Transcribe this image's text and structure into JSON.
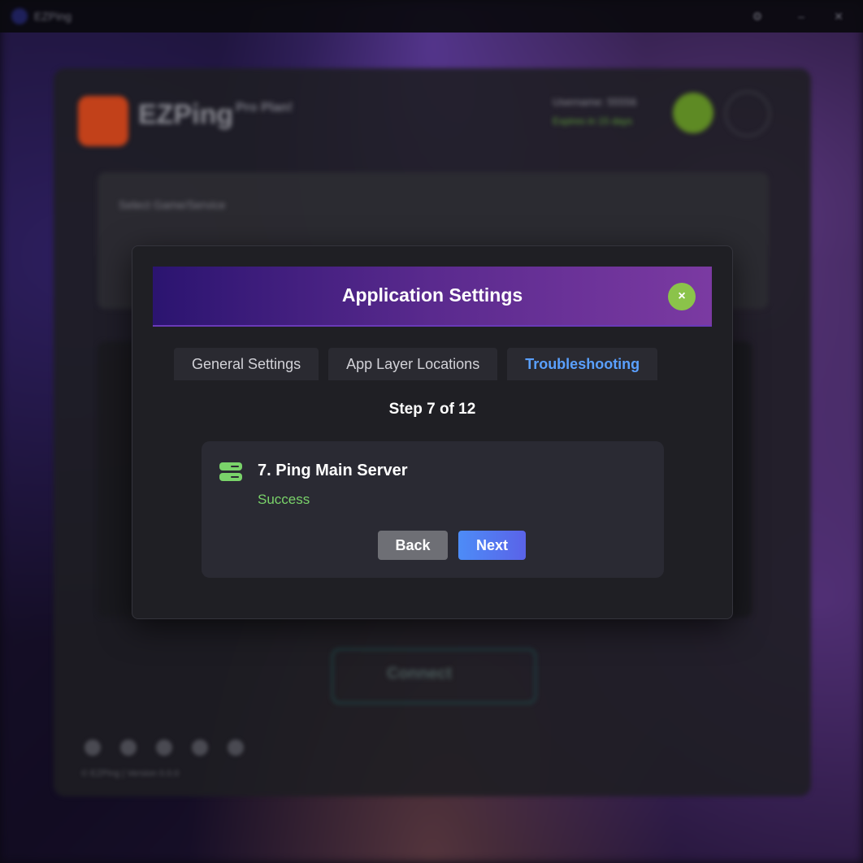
{
  "titlebar": {
    "app_name": "EZPing",
    "controls": [
      "gear-icon",
      "minimize-icon",
      "close-icon"
    ]
  },
  "background_app": {
    "brand": "EZPing",
    "plan": "Pro Plan!",
    "username": "Username: 55556",
    "expires": "Expires in 15 days",
    "select_label": "Select Game/Service",
    "connect_label": "Connect",
    "copyright": "© EZPing | Version 0.0.0"
  },
  "modal": {
    "title": "Application Settings",
    "close_symbol": "×",
    "tabs": [
      {
        "label": "General Settings",
        "active": false
      },
      {
        "label": "App Layer Locations",
        "active": false
      },
      {
        "label": "Troubleshooting",
        "active": true
      }
    ],
    "step_label": "Step 7 of 12",
    "step": {
      "icon": "server-icon",
      "title": "7. Ping Main Server",
      "status": "Success"
    },
    "back_label": "Back",
    "next_label": "Next"
  },
  "colors": {
    "accent": "#5aa0ff",
    "success": "#7ad36a",
    "close_button": "#8bc34a",
    "header_start": "#2b1470",
    "header_end": "#7b3aa2"
  }
}
